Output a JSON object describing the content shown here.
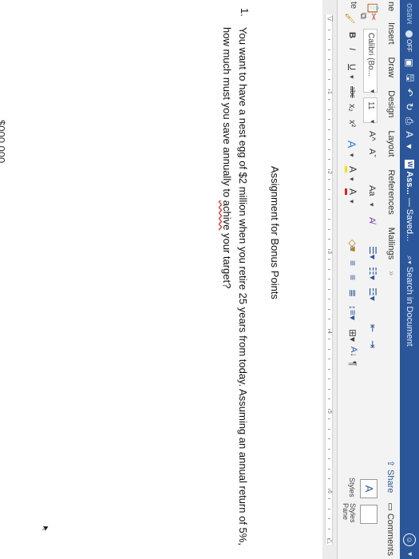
{
  "titlebar": {
    "autosave_cut": "osave",
    "toggle_label": "OFF",
    "doc_name": "Ass...",
    "saved_status": "— Saved...",
    "search_placeholder": "Search in Document",
    "color": "#2b579a"
  },
  "ribbon_tabs": {
    "home_cut": "ne",
    "items": [
      "Insert",
      "Draw",
      "Design",
      "Layout",
      "References",
      "Mailings"
    ],
    "share": "Share",
    "comments": "Comments"
  },
  "toolbar": {
    "paste_cut": "te",
    "font_name": "Calibri (Bo...",
    "font_size": "11",
    "grow_font": "A^",
    "shrink_font": "Aˇ",
    "change_case": "Aa",
    "bold": "B",
    "italic": "I",
    "underline": "U",
    "strikethrough": "abc",
    "subscript": "x₂",
    "superscript": "x²",
    "text_effects": "A",
    "highlight": "A",
    "font_color": "A",
    "styles_label": "Styles",
    "styles_pane_label": "Styles Pane"
  },
  "ruler": {
    "numbers": [
      "1",
      "2",
      "3",
      "4",
      "5",
      "6"
    ]
  },
  "document": {
    "title": "Assignment for Bonus Points",
    "question_number": "1.",
    "question_before": "You want to have a nest egg of $2 million when you retire 25 years from today. Assuming an annual return of 5%, how much must you save annually to ",
    "question_misspelled": "achive",
    "question_after": " your target?",
    "cut_off_line": "$000,000"
  }
}
